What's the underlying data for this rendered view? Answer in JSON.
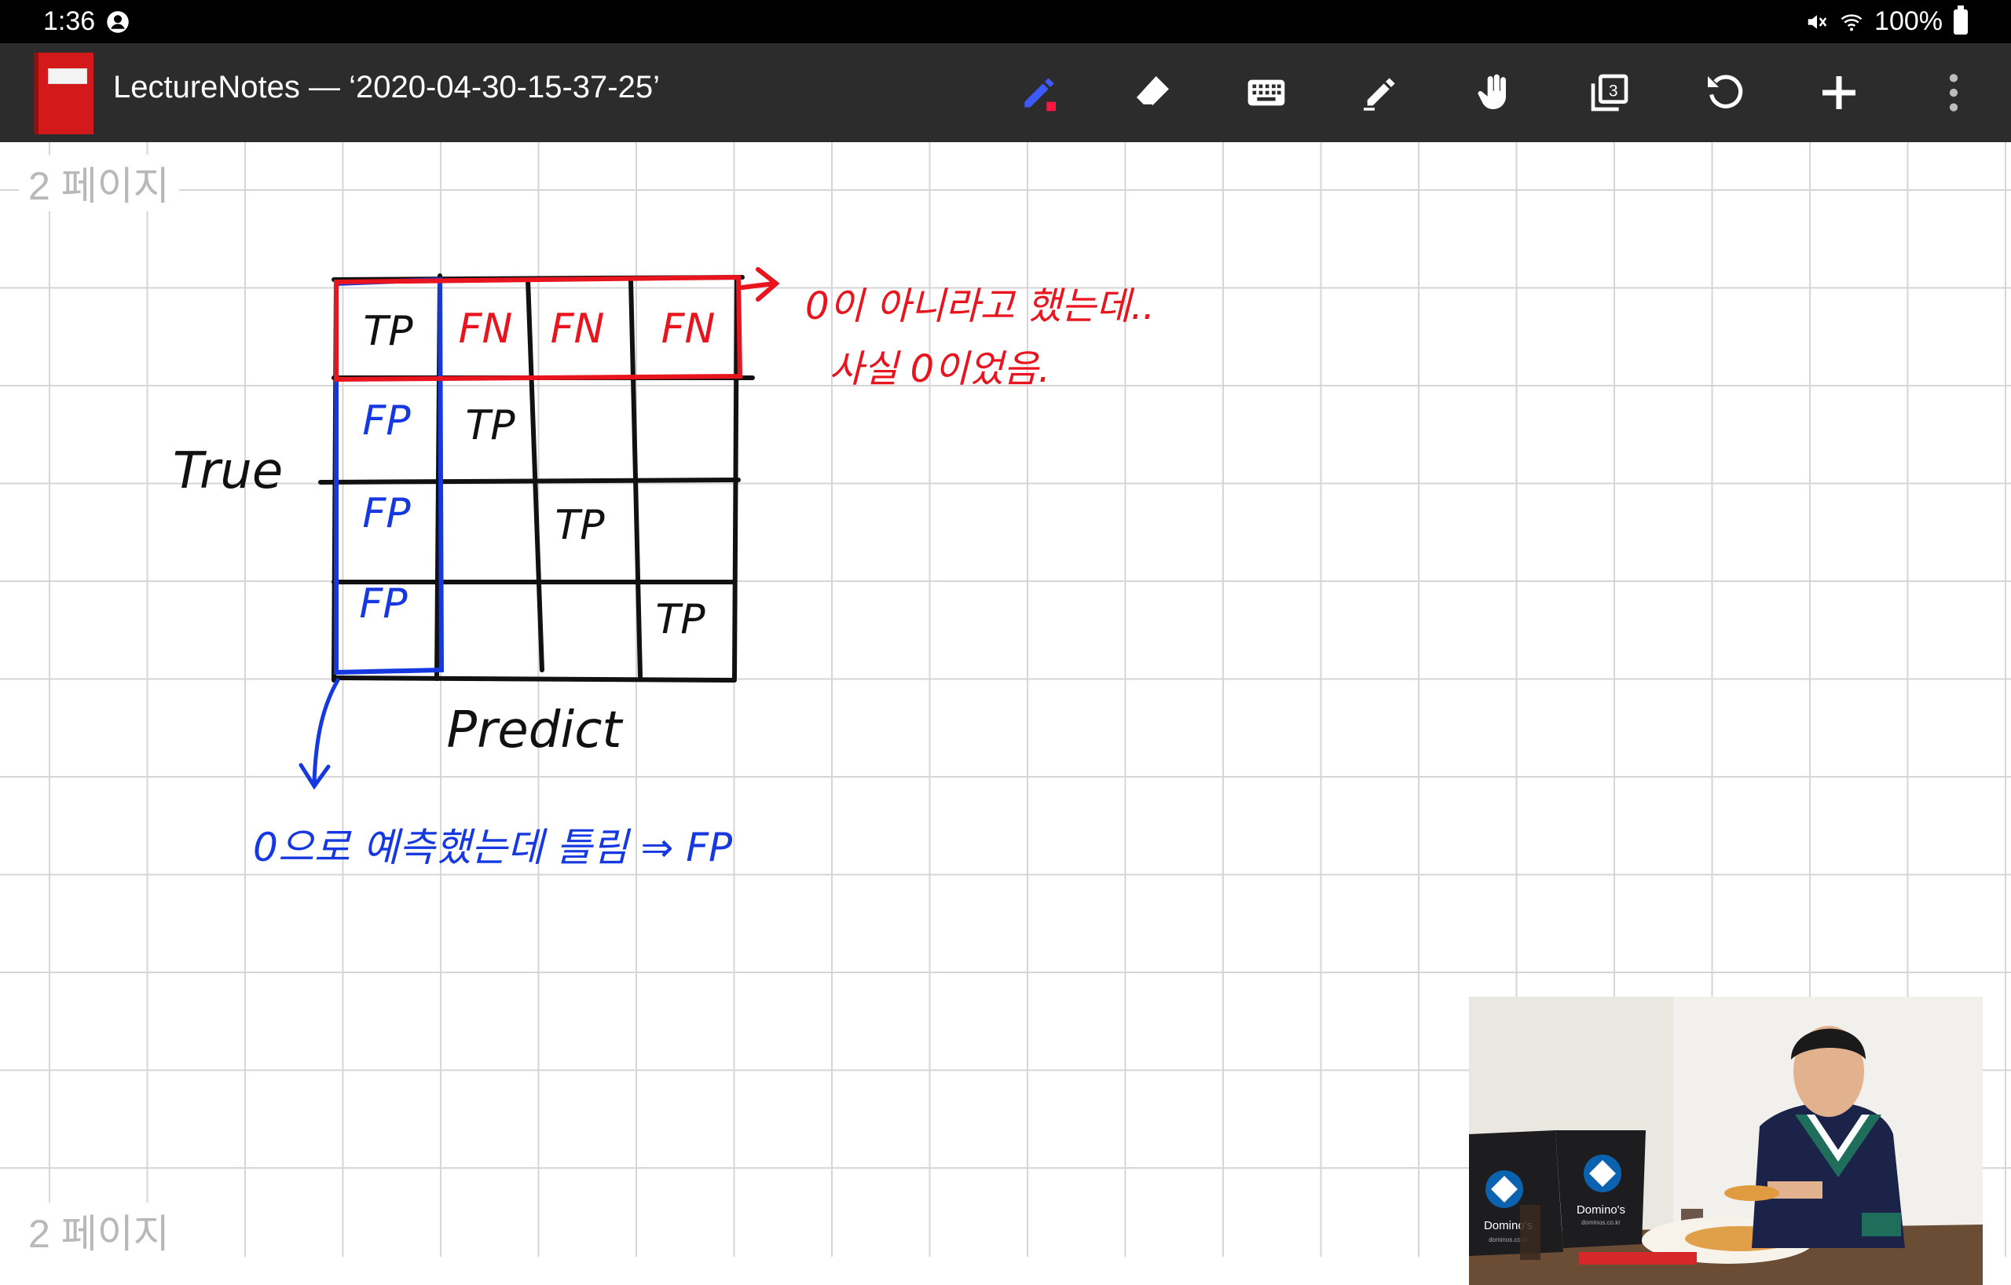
{
  "status_bar": {
    "time": "1:36",
    "battery": "100%",
    "icons": [
      "account-circle-icon",
      "mute-icon",
      "wifi-icon",
      "battery-icon"
    ]
  },
  "app_bar": {
    "title": "LectureNotes — ‘2020-04-30-15-37-25’",
    "tools": [
      "pen-icon",
      "eraser-icon",
      "keyboard-icon",
      "highlighter-icon",
      "hand-icon",
      "page-count-icon",
      "undo-icon",
      "add-icon",
      "more-vert-icon"
    ],
    "page_count": "3",
    "accent_color": "#3d5afe",
    "toolbar_color": "#2c2c2c"
  },
  "canvas": {
    "page_label_top": "2 페이지",
    "page_label_bottom": "2 페이지"
  },
  "handwriting": {
    "row_axis": "True",
    "col_axis": "Predict",
    "cells": {
      "r1": [
        "TP",
        "FN",
        "FN",
        "FN"
      ],
      "r2": [
        "FP",
        "TP"
      ],
      "r3": [
        "FP",
        "TP"
      ],
      "r4": [
        "FP",
        "TP"
      ]
    },
    "red_note_line1": "0이 아니라고 했는데..",
    "red_note_line2": "사실 0이었음.",
    "blue_note": "0으로 예측했는데 틀림 ⇒ FP",
    "colors": {
      "red": "#e8141e",
      "blue": "#1538e0",
      "black": "#111111"
    }
  },
  "video_overlay": {
    "box_label": "Domino's",
    "box_sublabel": "dominos.co.kr"
  }
}
